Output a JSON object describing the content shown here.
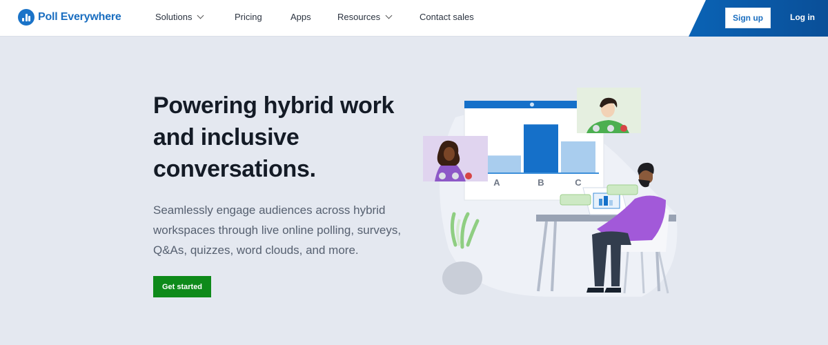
{
  "nav": {
    "brand": "Poll Everywhere",
    "items": [
      {
        "label": "Solutions",
        "has_dropdown": true
      },
      {
        "label": "Pricing",
        "has_dropdown": false
      },
      {
        "label": "Apps",
        "has_dropdown": false
      },
      {
        "label": "Resources",
        "has_dropdown": true
      },
      {
        "label": "Contact sales",
        "has_dropdown": false
      }
    ],
    "signup_label": "Sign up",
    "login_label": "Log in"
  },
  "hero": {
    "headline_lines": [
      "Powering hybrid work",
      "and inclusive",
      "conversations."
    ],
    "subtext_lines": [
      "Seamlessly engage audiences across hybrid",
      "workspaces through live online polling, surveys,",
      "Q&As, quizzes, word clouds, and more."
    ],
    "cta_label": "Get started"
  },
  "illustration": {
    "poll_bars": [
      {
        "label": "A",
        "value": 0.3
      },
      {
        "label": "B",
        "value": 0.85
      },
      {
        "label": "C",
        "value": 0.55
      }
    ]
  },
  "colors": {
    "brand_blue": "#1a6ec0",
    "cta_green": "#0e8a1a",
    "background": "#e4e8f0"
  }
}
